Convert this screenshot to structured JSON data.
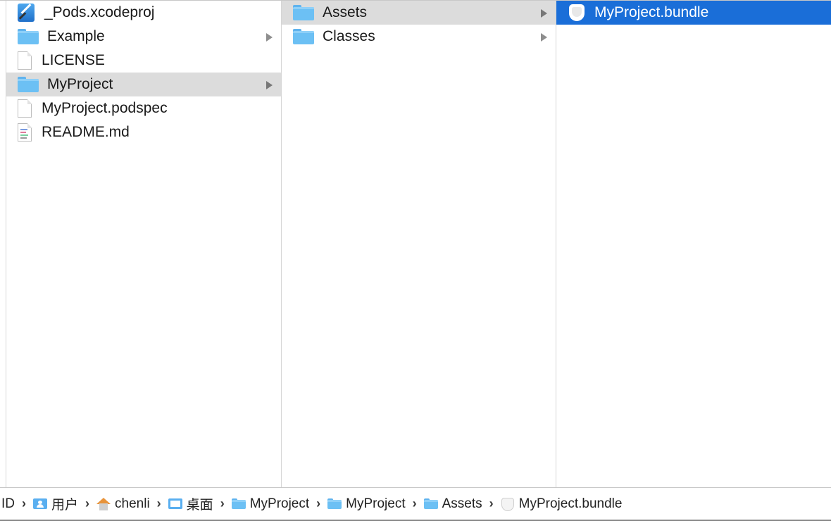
{
  "columns": {
    "root": [
      {
        "label": "_Pods.xcodeproj",
        "icon": "xcode-project-icon",
        "has_children": false,
        "state": "none"
      },
      {
        "label": "Example",
        "icon": "folder-icon",
        "has_children": true,
        "state": "none"
      },
      {
        "label": "LICENSE",
        "icon": "document-icon",
        "has_children": false,
        "state": "none"
      },
      {
        "label": "MyProject",
        "icon": "folder-icon",
        "has_children": true,
        "state": "path-selected"
      },
      {
        "label": "MyProject.podspec",
        "icon": "document-icon",
        "has_children": false,
        "state": "none"
      },
      {
        "label": "README.md",
        "icon": "markdown-document-icon",
        "has_children": false,
        "state": "none"
      }
    ],
    "myproject": [
      {
        "label": "Assets",
        "icon": "folder-icon",
        "has_children": true,
        "state": "path-selected"
      },
      {
        "label": "Classes",
        "icon": "folder-icon",
        "has_children": true,
        "state": "none"
      }
    ],
    "assets": [
      {
        "label": "MyProject.bundle",
        "icon": "bundle-icon",
        "has_children": true,
        "state": "selected"
      }
    ]
  },
  "pathbar": {
    "leading": "ID",
    "crumbs": [
      {
        "label": "用户",
        "icon": "user-folder-icon"
      },
      {
        "label": "chenli",
        "icon": "home-icon"
      },
      {
        "label": "桌面",
        "icon": "desktop-icon"
      },
      {
        "label": "MyProject",
        "icon": "folder-icon"
      },
      {
        "label": "MyProject",
        "icon": "folder-icon"
      },
      {
        "label": "Assets",
        "icon": "folder-icon"
      },
      {
        "label": "MyProject.bundle",
        "icon": "bundle-icon"
      }
    ],
    "separator": "›"
  },
  "colors": {
    "selection_blue": "#1a6ed8",
    "path_gray": "#dcdcdc",
    "folder_blue": "#6cc0f4"
  }
}
